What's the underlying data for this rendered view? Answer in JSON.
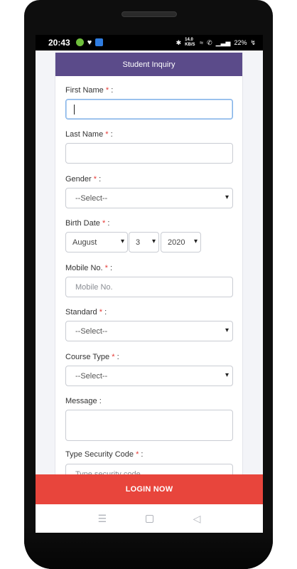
{
  "status_bar": {
    "time": "20:43",
    "network_speed": "14.0 KB/S",
    "battery": "22%",
    "icons": [
      "app-icon-green",
      "heart-icon",
      "vpn-icon",
      "bluetooth-icon",
      "wifi-icon",
      "call-icon",
      "signal-icon",
      "battery-icon"
    ]
  },
  "form": {
    "title": "Student Inquiry",
    "first_name": {
      "label": "First Name",
      "req": "*",
      "suffix": ":",
      "value": ""
    },
    "last_name": {
      "label": "Last Name",
      "req": "*",
      "suffix": ":",
      "value": ""
    },
    "gender": {
      "label": "Gender",
      "req": "*",
      "suffix": ":",
      "selected": "--Select--"
    },
    "birth_date": {
      "label": "Birth Date",
      "req": "*",
      "suffix": ":",
      "month": "August",
      "day": "3",
      "year": "2020"
    },
    "mobile": {
      "label": "Mobile No.",
      "req": "*",
      "suffix": ":",
      "placeholder": "Mobile No."
    },
    "standard": {
      "label": "Standard",
      "req": "*",
      "suffix": ":",
      "selected": "--Select--"
    },
    "course_type": {
      "label": "Course Type",
      "req": "*",
      "suffix": ":",
      "selected": "--Select--"
    },
    "message": {
      "label": "Message",
      "suffix": ":"
    },
    "security_code": {
      "label": "Type Security Code",
      "req": "*",
      "suffix": ":",
      "placeholder": "Type security code"
    }
  },
  "submit": {
    "label": "LOGIN NOW"
  },
  "colors": {
    "header": "#5b4b8a",
    "button": "#e8453c",
    "required": "#e53935"
  },
  "nav": {
    "icons": [
      "menu-icon",
      "home-square-icon",
      "back-triangle-icon"
    ]
  }
}
